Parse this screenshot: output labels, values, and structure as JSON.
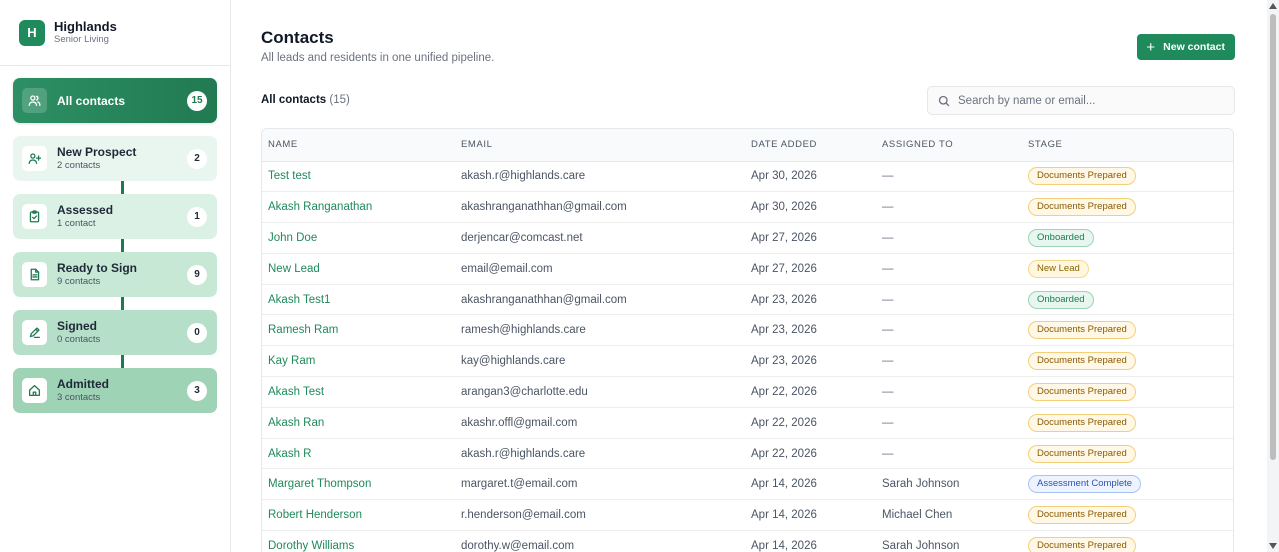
{
  "brand": {
    "logo_letter": "H",
    "name": "Highlands",
    "subtitle": "Senior Living"
  },
  "colors": {
    "accent": "#1f8a5b",
    "accent_dark": "#1f7a52"
  },
  "sidebar": {
    "stages": [
      {
        "label": "All contacts",
        "count": "15",
        "icon": "users-icon",
        "active": true
      },
      {
        "label": "New Prospect",
        "sub": "2 contacts",
        "count": "2",
        "icon": "user-plus-icon"
      },
      {
        "label": "Assessed",
        "sub": "1 contact",
        "count": "1",
        "icon": "clipboard-check-icon"
      },
      {
        "label": "Ready to Sign",
        "sub": "9 contacts",
        "count": "9",
        "icon": "document-icon"
      },
      {
        "label": "Signed",
        "sub": "0 contacts",
        "count": "0",
        "icon": "pen-icon"
      },
      {
        "label": "Admitted",
        "sub": "3 contacts",
        "count": "3",
        "icon": "home-icon"
      }
    ]
  },
  "header": {
    "title": "Contacts",
    "subtitle": "All leads and residents in one unified pipeline.",
    "new_button": "New contact"
  },
  "list": {
    "title": "All contacts",
    "count": "(15)",
    "search_placeholder": "Search by name or email..."
  },
  "table": {
    "columns": [
      "NAME",
      "EMAIL",
      "DATE ADDED",
      "ASSIGNED TO",
      "STAGE"
    ],
    "rows": [
      {
        "name": "Test test",
        "email": "akash.r@highlands.care",
        "date": "Apr 30, 2026",
        "assigned": "—",
        "stage": "Documents Prepared",
        "stage_kind": "doc"
      },
      {
        "name": "Akash Ranganathan",
        "email": "akashranganathhan@gmail.com",
        "date": "Apr 30, 2026",
        "assigned": "—",
        "stage": "Documents Prepared",
        "stage_kind": "doc"
      },
      {
        "name": "John Doe",
        "email": "derjencar@comcast.net",
        "date": "Apr 27, 2026",
        "assigned": "—",
        "stage": "Onboarded",
        "stage_kind": "onb"
      },
      {
        "name": "New Lead",
        "email": "email@email.com",
        "date": "Apr 27, 2026",
        "assigned": "—",
        "stage": "New Lead",
        "stage_kind": "lead"
      },
      {
        "name": "Akash Test1",
        "email": "akashranganathhan@gmail.com",
        "date": "Apr 23, 2026",
        "assigned": "—",
        "stage": "Onboarded",
        "stage_kind": "onb"
      },
      {
        "name": "Ramesh Ram",
        "email": "ramesh@highlands.care",
        "date": "Apr 23, 2026",
        "assigned": "—",
        "stage": "Documents Prepared",
        "stage_kind": "doc"
      },
      {
        "name": "Kay Ram",
        "email": "kay@highlands.care",
        "date": "Apr 23, 2026",
        "assigned": "—",
        "stage": "Documents Prepared",
        "stage_kind": "doc"
      },
      {
        "name": "Akash Test",
        "email": "arangan3@charlotte.edu",
        "date": "Apr 22, 2026",
        "assigned": "—",
        "stage": "Documents Prepared",
        "stage_kind": "doc"
      },
      {
        "name": "Akash Ran",
        "email": "akashr.offl@gmail.com",
        "date": "Apr 22, 2026",
        "assigned": "—",
        "stage": "Documents Prepared",
        "stage_kind": "doc"
      },
      {
        "name": "Akash R",
        "email": "akash.r@highlands.care",
        "date": "Apr 22, 2026",
        "assigned": "—",
        "stage": "Documents Prepared",
        "stage_kind": "doc"
      },
      {
        "name": "Margaret Thompson",
        "email": "margaret.t@email.com",
        "date": "Apr 14, 2026",
        "assigned": "Sarah Johnson",
        "stage": "Assessment Complete",
        "stage_kind": "assess"
      },
      {
        "name": "Robert Henderson",
        "email": "r.henderson@email.com",
        "date": "Apr 14, 2026",
        "assigned": "Michael Chen",
        "stage": "Documents Prepared",
        "stage_kind": "doc"
      },
      {
        "name": "Dorothy Williams",
        "email": "dorothy.w@email.com",
        "date": "Apr 14, 2026",
        "assigned": "Sarah Johnson",
        "stage": "Documents Prepared",
        "stage_kind": "doc"
      }
    ]
  }
}
